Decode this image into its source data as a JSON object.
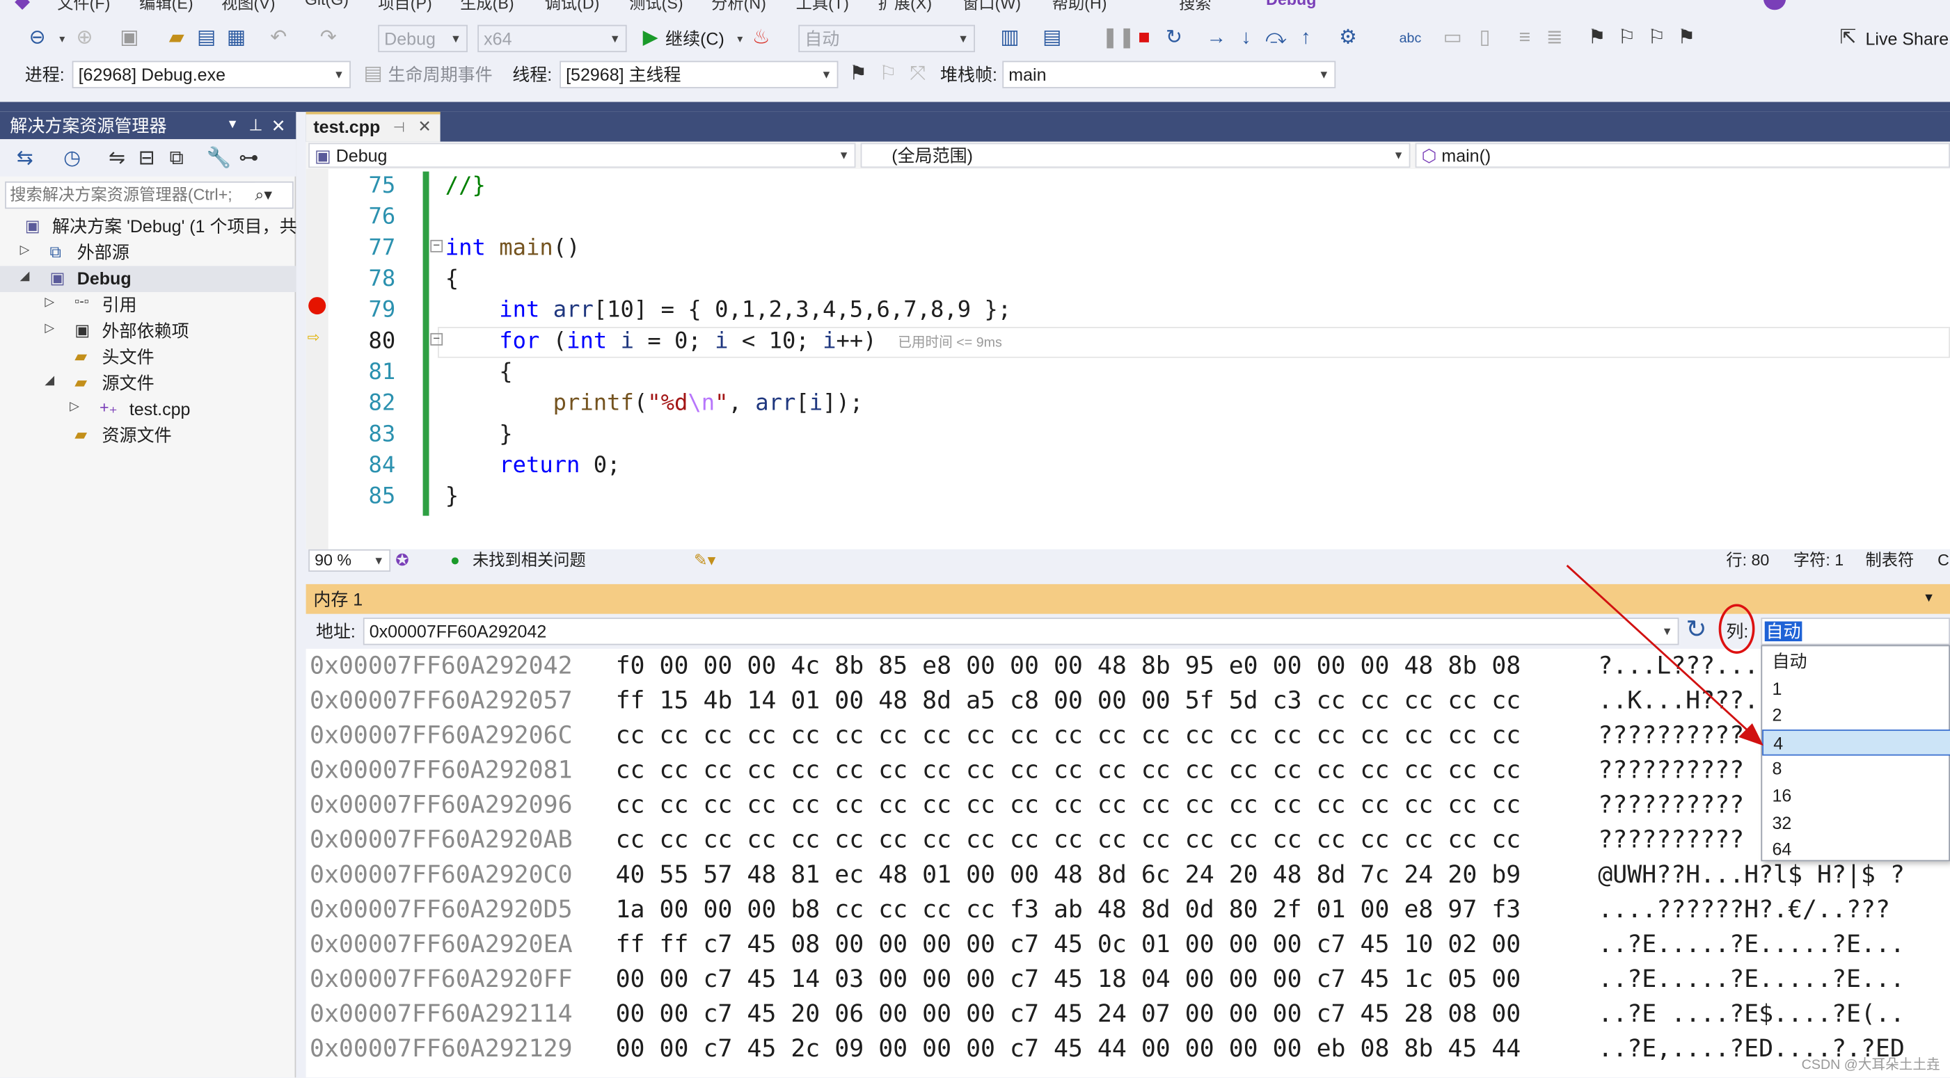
{
  "menu": [
    "文件(F)",
    "编辑(E)",
    "视图(V)",
    "Git(G)",
    "项目(P)",
    "生成(B)",
    "调试(D)",
    "测试(S)",
    "分析(N)",
    "工具(T)",
    "扩展(X)",
    "窗口(W)",
    "帮助(H)",
    "搜索",
    "Debug"
  ],
  "toolbar1": {
    "config": "Debug",
    "platform": "x64",
    "continue_label": "继续(C)",
    "auto_combo": "自动",
    "live_share": "Live Share"
  },
  "toolbar2": {
    "process_label": "进程:",
    "process_value": "[62968] Debug.exe",
    "lifecycle_label": "生命周期事件",
    "thread_label": "线程:",
    "thread_value": "[52968] 主线程",
    "stackframe_label": "堆栈帧:",
    "stackframe_value": "main"
  },
  "solution_explorer": {
    "title": "解决方案资源管理器",
    "search_placeholder": "搜索解决方案资源管理器(Ctrl+;",
    "items": [
      {
        "label": "解决方案 'Debug' (1 个项目，共"
      },
      {
        "label": "外部源"
      },
      {
        "label": "Debug"
      },
      {
        "label": "引用"
      },
      {
        "label": "外部依赖项"
      },
      {
        "label": "头文件"
      },
      {
        "label": "源文件"
      },
      {
        "label": "test.cpp"
      },
      {
        "label": "资源文件"
      }
    ]
  },
  "editor": {
    "tab_label": "test.cpp",
    "nav_project": "Debug",
    "nav_scope": "(全局范围)",
    "nav_function": "main()",
    "line_numbers": [
      "75",
      "76",
      "77",
      "78",
      "79",
      "80",
      "81",
      "82",
      "83",
      "84",
      "85"
    ],
    "elapsed_hint": "已用时间 <= 9ms",
    "zoom": "90 %",
    "issues": "未找到相关问题",
    "row": "行: 80",
    "char": "字符: 1",
    "tab_mode": "制表符",
    "tab_mode_tail": "C"
  },
  "memory": {
    "title": "内存 1",
    "address_label": "地址:",
    "address_value": "0x00007FF60A292042",
    "columns_label": "列:",
    "columns_value": "自动",
    "columns_options": [
      "自动",
      "1",
      "2",
      "4",
      "8",
      "16",
      "32",
      "64"
    ],
    "columns_selected_index": 3,
    "rows": [
      {
        "addr": "0x00007FF60A292042",
        "hex": "f0 00 00 00 4c 8b 85 e8 00 00 00 48 8b 95 e0 00 00 00 48 8b 08",
        "ascii": "?...L???..."
      },
      {
        "addr": "0x00007FF60A292057",
        "hex": "ff 15 4b 14 01 00 48 8d a5 c8 00 00 00 5f 5d c3 cc cc cc cc cc",
        "ascii": "..K...H???."
      },
      {
        "addr": "0x00007FF60A29206C",
        "hex": "cc cc cc cc cc cc cc cc cc cc cc cc cc cc cc cc cc cc cc cc cc",
        "ascii": "??????????"
      },
      {
        "addr": "0x00007FF60A292081",
        "hex": "cc cc cc cc cc cc cc cc cc cc cc cc cc cc cc cc cc cc cc cc cc",
        "ascii": "??????????"
      },
      {
        "addr": "0x00007FF60A292096",
        "hex": "cc cc cc cc cc cc cc cc cc cc cc cc cc cc cc cc cc cc cc cc cc",
        "ascii": "??????????"
      },
      {
        "addr": "0x00007FF60A2920AB",
        "hex": "cc cc cc cc cc cc cc cc cc cc cc cc cc cc cc cc cc cc cc cc cc",
        "ascii": "??????????"
      },
      {
        "addr": "0x00007FF60A2920C0",
        "hex": "40 55 57 48 81 ec 48 01 00 00 48 8d 6c 24 20 48 8d 7c 24 20 b9",
        "ascii": "@UWH??H...H?l$ H?|$ ?"
      },
      {
        "addr": "0x00007FF60A2920D5",
        "hex": "1a 00 00 00 b8 cc cc cc cc f3 ab 48 8d 0d 80 2f 01 00 e8 97 f3",
        "ascii": "....??????H?.€/..???"
      },
      {
        "addr": "0x00007FF60A2920EA",
        "hex": "ff ff c7 45 08 00 00 00 00 c7 45 0c 01 00 00 00 c7 45 10 02 00",
        "ascii": "..?E.....?E.....?E..."
      },
      {
        "addr": "0x00007FF60A2920FF",
        "hex": "00 00 c7 45 14 03 00 00 00 c7 45 18 04 00 00 00 c7 45 1c 05 00",
        "ascii": "..?E.....?E.....?E..."
      },
      {
        "addr": "0x00007FF60A292114",
        "hex": "00 00 c7 45 20 06 00 00 00 c7 45 24 07 00 00 00 c7 45 28 08 00",
        "ascii": "..?E ....?E$....?E(.."
      },
      {
        "addr": "0x00007FF60A292129",
        "hex": "00 00 c7 45 2c 09 00 00 00 c7 45 44 00 00 00 00 eb 08 8b 45 44",
        "ascii": "..?E,....?ED....?.?ED"
      }
    ]
  },
  "watermark": "CSDN @大耳朵土土垚",
  "colors": {
    "accent": "#3d4d7a",
    "memory_header": "#f5cc84",
    "annotation": "#d11111"
  }
}
